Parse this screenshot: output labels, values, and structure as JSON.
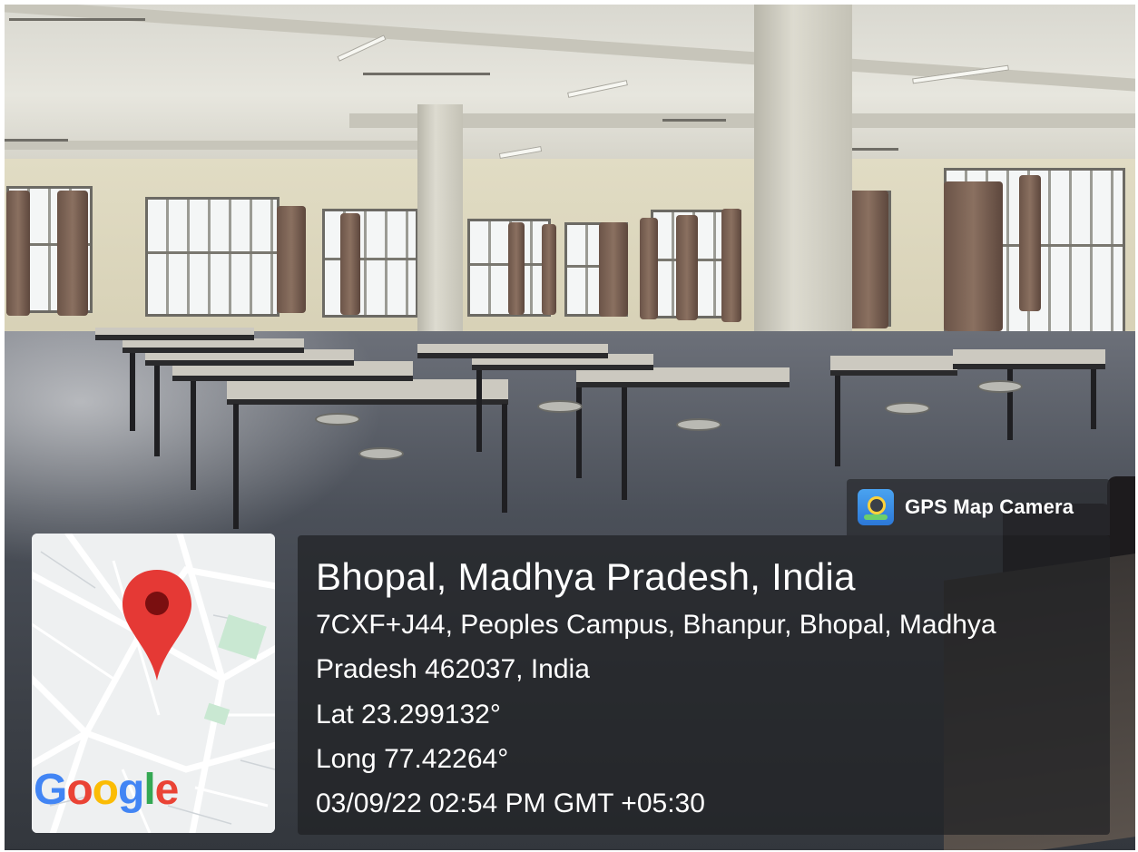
{
  "overlay": {
    "app_badge": {
      "label": "GPS Map Camera",
      "icon": "camera-location-icon"
    },
    "map": {
      "provider_logo": "Google",
      "pin_icon": "map-pin-icon",
      "colors": {
        "pin": "#e53935",
        "pin_center": "#7a0f10",
        "park": "#c9e8d2",
        "road": "#ffffff"
      }
    },
    "location": {
      "place": "Bhopal, Madhya Pradesh, India",
      "address_line1": "7CXF+J44, Peoples Campus, Bhanpur, Bhopal, Madhya",
      "address_line2": "Pradesh 462037, India",
      "latitude": "Lat 23.299132°",
      "longitude": "Long 77.42264°",
      "timestamp": "03/09/22 02:54 PM GMT +05:30"
    }
  },
  "scene": {
    "description_icon": "classroom-photo"
  }
}
